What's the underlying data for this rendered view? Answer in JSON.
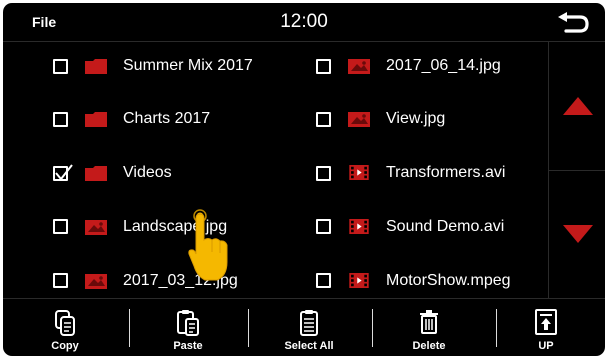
{
  "header": {
    "title": "File",
    "time": "12:00"
  },
  "colors": {
    "accent": "#c41a1a",
    "background": "#000000",
    "text": "#ffffff"
  },
  "left_items": [
    {
      "label": "Summer Mix 2017",
      "type": "folder",
      "checked": false
    },
    {
      "label": "Charts 2017",
      "type": "folder",
      "checked": false
    },
    {
      "label": "Videos",
      "type": "folder",
      "checked": true
    },
    {
      "label": "Landscape.jpg",
      "type": "image",
      "checked": false
    },
    {
      "label": "2017_03_12.jpg",
      "type": "image",
      "checked": false
    }
  ],
  "right_items": [
    {
      "label": "2017_06_14.jpg",
      "type": "image",
      "checked": false
    },
    {
      "label": "View.jpg",
      "type": "image",
      "checked": false
    },
    {
      "label": "Transformers.avi",
      "type": "video",
      "checked": false
    },
    {
      "label": "Sound Demo.avi",
      "type": "video",
      "checked": false
    },
    {
      "label": "MotorShow.mpeg",
      "type": "video",
      "checked": false
    }
  ],
  "toolbar": {
    "copy": "Copy",
    "paste": "Paste",
    "select_all": "Select All",
    "delete": "Delete",
    "up": "UP"
  },
  "icons": {
    "back": "back-arrow-icon",
    "scroll_up": "triangle-up-icon",
    "scroll_down": "triangle-down-icon",
    "touch": "pointing-hand-icon"
  }
}
